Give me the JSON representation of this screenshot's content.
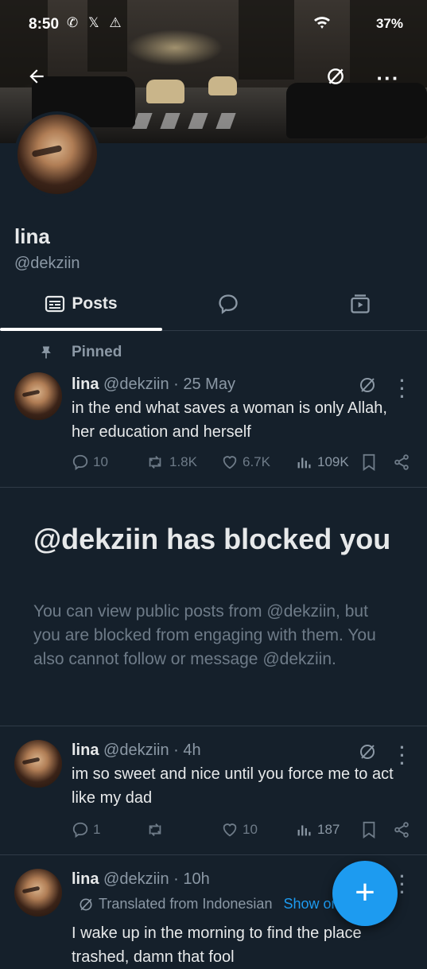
{
  "status_bar": {
    "time": "8:50",
    "battery": "37%",
    "left_icons": "✆ 𝕏 ⚠",
    "right_icons": "▽ ✆"
  },
  "profile": {
    "name": "lina",
    "handle": "@dekziin"
  },
  "tabs": [
    {
      "label": "Posts",
      "active": true
    },
    {
      "label": "Replies"
    },
    {
      "label": "Media"
    }
  ],
  "pinned_label": "Pinned",
  "posts": [
    {
      "name": "lina",
      "handle": "@dekziin",
      "sep": "·",
      "time": "25 May",
      "text": "in the end what saves a woman is only Allah, her education and herself",
      "replies": "10",
      "reposts": "1.8K",
      "likes": "6.7K",
      "views": "109K"
    },
    {
      "name": "lina",
      "handle": "@dekziin",
      "sep": "·",
      "time": "4h",
      "text": "im so sweet and nice until you force me to act like my dad",
      "replies": "1",
      "reposts": "",
      "likes": "10",
      "views": "187"
    },
    {
      "name": "lina",
      "handle": "@dekziin",
      "sep": "·",
      "time": "10h",
      "translated": "Translated from Indonesian",
      "show_original": "Show original",
      "text": "I wake up in the morning to find the place trashed, damn that fool"
    }
  ],
  "blocked": {
    "title": "@dekziin has blocked you",
    "body": "You can view public posts from @dekziin, but you are blocked from engaging with them. You also cannot follow or message @dekziin."
  },
  "fab_label": "+",
  "colors": {
    "background": "#15202b",
    "accent": "#1d9bf0",
    "muted": "#8b98a5"
  }
}
